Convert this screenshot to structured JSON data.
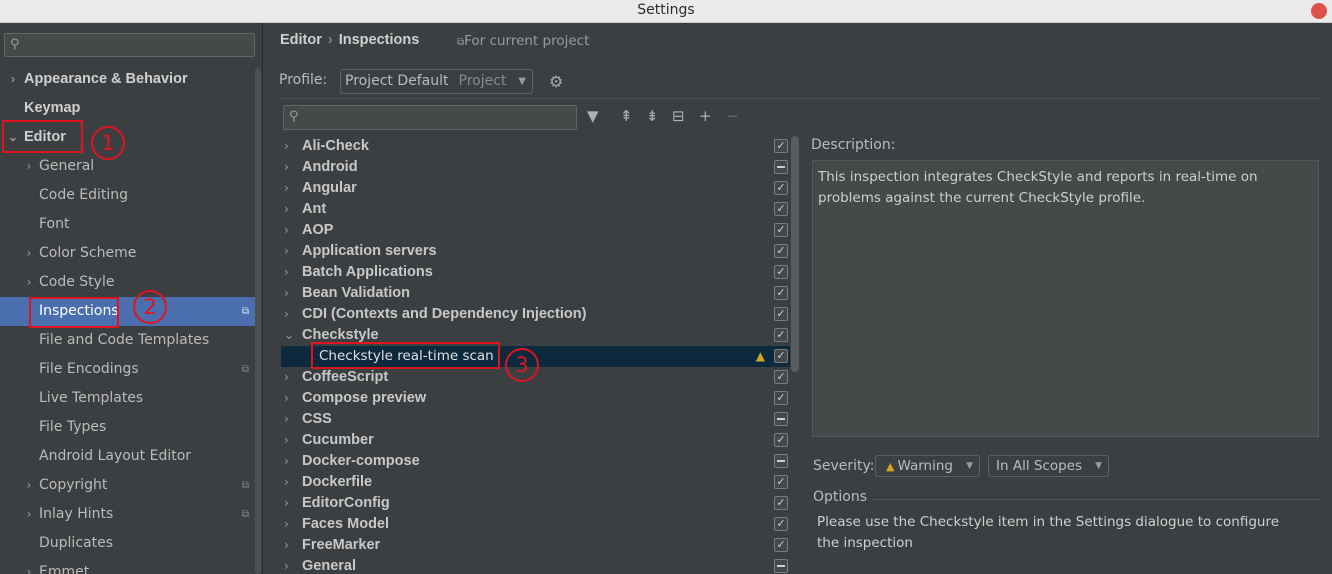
{
  "window": {
    "title": "Settings"
  },
  "sidebar": {
    "items": [
      {
        "label": "Appearance & Behavior",
        "arrow": "›",
        "bold": true
      },
      {
        "label": "Keymap",
        "arrow": "",
        "bold": true
      },
      {
        "label": "Editor",
        "arrow": "⌄",
        "bold": true
      },
      {
        "label": "General",
        "arrow": "›"
      },
      {
        "label": "Code Editing",
        "arrow": ""
      },
      {
        "label": "Font",
        "arrow": ""
      },
      {
        "label": "Color Scheme",
        "arrow": "›"
      },
      {
        "label": "Code Style",
        "arrow": "›"
      },
      {
        "label": "Inspections",
        "arrow": "",
        "selected": true,
        "project_icon": "⧉"
      },
      {
        "label": "File and Code Templates",
        "arrow": ""
      },
      {
        "label": "File Encodings",
        "arrow": "",
        "project_icon": "⧉"
      },
      {
        "label": "Live Templates",
        "arrow": ""
      },
      {
        "label": "File Types",
        "arrow": ""
      },
      {
        "label": "Android Layout Editor",
        "arrow": ""
      },
      {
        "label": "Copyright",
        "arrow": "›",
        "project_icon": "⧉"
      },
      {
        "label": "Inlay Hints",
        "arrow": "›",
        "project_icon": "⧉"
      },
      {
        "label": "Duplicates",
        "arrow": ""
      },
      {
        "label": "Emmet",
        "arrow": "›"
      }
    ]
  },
  "header": {
    "breadcrumb": [
      "Editor",
      "Inspections"
    ],
    "breadcrumb_sep": "›",
    "for_project": "For current project"
  },
  "profile": {
    "label": "Profile:",
    "value": "Project Default",
    "scope": "Project"
  },
  "inspections": [
    {
      "label": "Ali-Check",
      "state": "checked"
    },
    {
      "label": "Android",
      "state": "mixed"
    },
    {
      "label": "Angular",
      "state": "checked"
    },
    {
      "label": "Ant",
      "state": "checked"
    },
    {
      "label": "AOP",
      "state": "checked"
    },
    {
      "label": "Application servers",
      "state": "checked"
    },
    {
      "label": "Batch Applications",
      "state": "checked"
    },
    {
      "label": "Bean Validation",
      "state": "checked"
    },
    {
      "label": "CDI (Contexts and Dependency Injection)",
      "state": "checked"
    },
    {
      "label": "Checkstyle",
      "state": "checked",
      "expanded": true
    },
    {
      "label": "Checkstyle real-time scan",
      "state": "checked",
      "child": true,
      "warning": true
    },
    {
      "label": "CoffeeScript",
      "state": "checked"
    },
    {
      "label": "Compose preview",
      "state": "checked"
    },
    {
      "label": "CSS",
      "state": "mixed"
    },
    {
      "label": "Cucumber",
      "state": "checked"
    },
    {
      "label": "Docker-compose",
      "state": "mixed"
    },
    {
      "label": "Dockerfile",
      "state": "checked"
    },
    {
      "label": "EditorConfig",
      "state": "checked"
    },
    {
      "label": "Faces Model",
      "state": "checked"
    },
    {
      "label": "FreeMarker",
      "state": "checked"
    },
    {
      "label": "General",
      "state": "mixed"
    }
  ],
  "description": {
    "label": "Description:",
    "text": "This inspection integrates CheckStyle and reports in real-time on problems against the current CheckStyle profile."
  },
  "severity": {
    "label": "Severity:",
    "value": "Warning",
    "scope": "In All Scopes"
  },
  "options": {
    "label": "Options",
    "text": "Please use the Checkstyle item in the Settings dialogue to configure the inspection"
  },
  "annotations": [
    "1",
    "2",
    "3"
  ],
  "colors": {
    "selection": "#4b6eaf",
    "annotation": "#e0141e",
    "warning": "#d4a325"
  }
}
